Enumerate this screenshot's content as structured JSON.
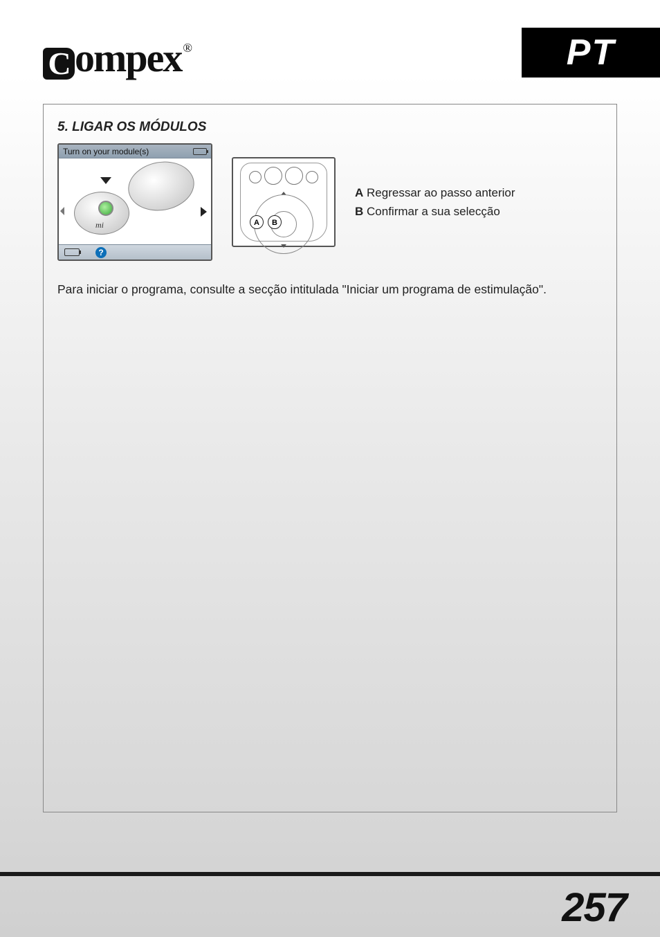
{
  "header": {
    "brand": "Compex",
    "registered": "®",
    "language_code": "PT"
  },
  "section": {
    "number": "5.",
    "title": "LIGAR OS MÓDULOS"
  },
  "device_screen": {
    "title": "Turn on your module(s)",
    "module_label": "mi",
    "help_icon": "?"
  },
  "remote": {
    "button_a": "A",
    "button_b": "B"
  },
  "legend": {
    "a_key": "A",
    "a_text": "Regressar ao passo anterior",
    "b_key": "B",
    "b_text": "Confirmar a sua selecção"
  },
  "body": {
    "paragraph": "Para iniciar o programa, consulte a secção intitulada \"Iniciar um programa de estimulação\"."
  },
  "footer": {
    "page_number": "257"
  }
}
